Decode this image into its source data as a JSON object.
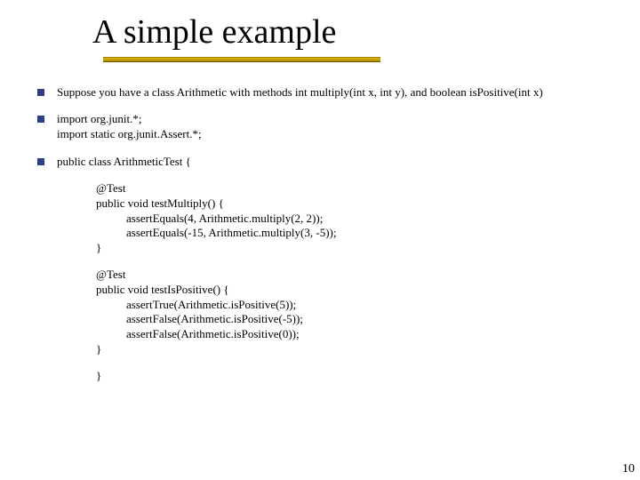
{
  "title": "A simple example",
  "bullets": {
    "b1a": "Suppose you have a class ",
    "b1b": "Arithmetic",
    "b1c": " with methods ",
    "b1d": "int multiply(int x, int y),",
    "b1e": "  and ",
    "b1f": "boolean isPositive(int x)",
    "b2a": "import org.junit.*;",
    "b2b": "import static org.junit.Assert.*;",
    "b3": "public class ArithmeticTest {"
  },
  "block1": {
    "l1": "@Test",
    "l2": "public void testMultiply() {",
    "l3": "assertEquals(4, Arithmetic.multiply(2, 2));",
    "l4": "assertEquals(-15, Arithmetic.multiply(3, -5));",
    "l5": "}"
  },
  "block2": {
    "l1": "@Test",
    "l2": "public void testIsPositive() {",
    "l3": "assertTrue(Arithmetic.isPositive(5));",
    "l4": "assertFalse(Arithmetic.isPositive(-5));",
    "l5": "assertFalse(Arithmetic.isPositive(0));",
    "l6": "}"
  },
  "close": "}",
  "pagenum": "10"
}
